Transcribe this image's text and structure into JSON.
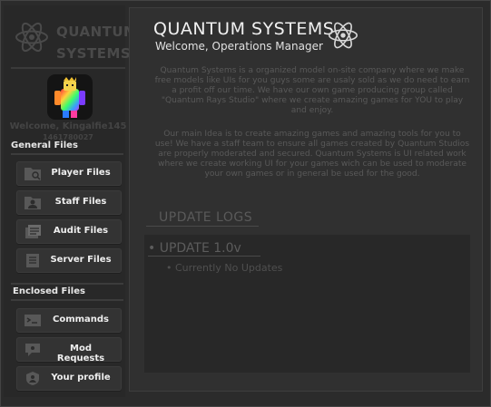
{
  "brand": {
    "line1": "QUANTUM",
    "line2": "SYSTEMS"
  },
  "user": {
    "welcome": "Welcome, Kingalfie145",
    "id": "1461780027"
  },
  "sidebar": {
    "general_label": "General Files",
    "general_items": [
      {
        "label": "Player Files",
        "icon": "player-file-icon"
      },
      {
        "label": "Staff Files",
        "icon": "staff-file-icon"
      },
      {
        "label": "Audit Files",
        "icon": "audit-file-icon"
      },
      {
        "label": "Server Files",
        "icon": "server-file-icon"
      }
    ],
    "enclosed_label": "Enclosed Files",
    "enclosed_items": [
      {
        "label": "Commands",
        "icon": "commands-icon"
      },
      {
        "label": "Mod Requests",
        "icon": "mod-requests-icon"
      },
      {
        "label": "Your profile",
        "icon": "profile-shield-icon"
      }
    ]
  },
  "main": {
    "title": "QUANTUM SYSTEMS",
    "subtitle": "Welcome, Operations Manager",
    "paragraph1": "Quantum Systems is a organized model on-site company where we make free models like UIs for you guys some are usaly sold as we do need to earn a profit off our time. We have our own game producing group called \"Quantum Rays Studio\" where we create amazing games for YOU to play and enjoy.",
    "paragraph2": "Our main Idea is to create amazing games and amazing tools for you to use! We have a staff team to ensure all games created by Quantum Studios are properly moderated and secured. Quantum Systems is UI related work where we create working UI for your games wich can be used to moderate your own games or in general be used for the good.",
    "logs_title": "UPDATE LOGS",
    "log_heading": "• UPDATE 1.0v",
    "log_item": "• Currently No Updates"
  },
  "colors": {
    "background": "#2a2a2a",
    "panel": "#303030",
    "button": "#333333",
    "muted_text": "#595959"
  }
}
